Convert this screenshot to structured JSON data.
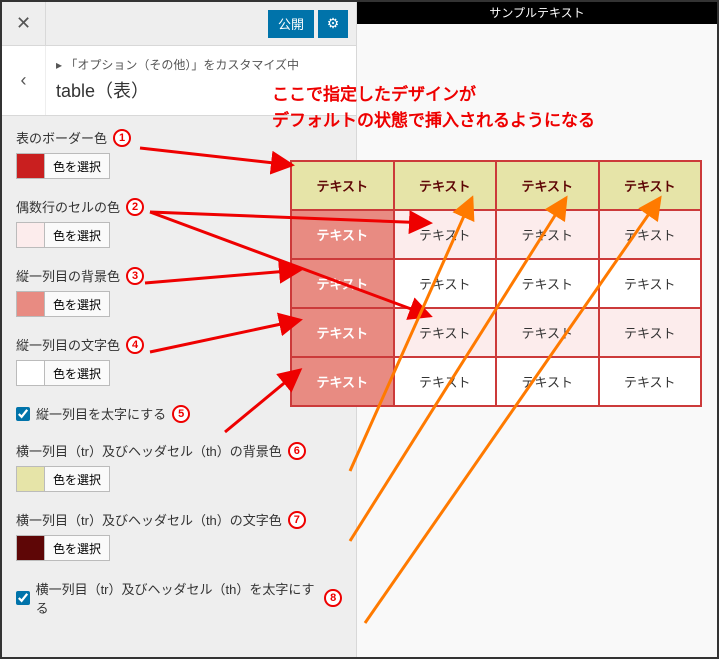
{
  "sidebar": {
    "publish_label": "公開",
    "breadcrumb": "▸ 「オプション（その他）」をカスタマイズ中",
    "title": "table（表）",
    "color_pick_label": "色を選択",
    "options": [
      {
        "label": "表のボーダー色",
        "swatch": "#c91f1f"
      },
      {
        "label": "偶数行のセルの色",
        "swatch": "#fcecec"
      },
      {
        "label": "縦一列目の背景色",
        "swatch": "#e88b82"
      },
      {
        "label": "縦一列目の文字色",
        "swatch": "#ffffff"
      }
    ],
    "check1_label": "縦一列目を太字にする",
    "option6_label": "横一列目（tr）及びヘッダセル（th）の背景色",
    "option6_swatch": "#e6e4a8",
    "option7_label": "横一列目（tr）及びヘッダセル（th）の文字色",
    "option7_swatch": "#5e0606",
    "check8_label": "横一列目（tr）及びヘッダセル（th）を太字にする"
  },
  "preview": {
    "header": "サンプルテキスト",
    "annotation_line1": "ここで指定したデザインが",
    "annotation_line2": "デフォルトの状態で挿入されるようになる",
    "cell_text": "テキスト"
  },
  "badges": {
    "n1": "1",
    "n2": "2",
    "n3": "3",
    "n4": "4",
    "n5": "5",
    "n6": "6",
    "n7": "7",
    "n8": "8"
  }
}
